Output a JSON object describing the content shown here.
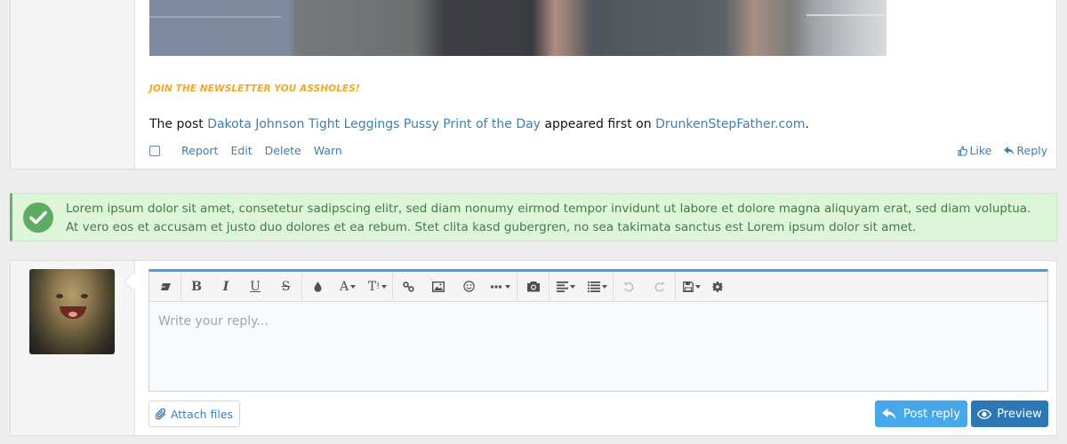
{
  "post": {
    "newsletter_text": "JOIN THE NEWSLETTER YOU ASSHOLES!",
    "text_prefix": "The post ",
    "post_link_text": "Dakota Johnson Tight Leggings Pussy Print of the Day",
    "text_middle": " appeared first on ",
    "site_link_text": "DrunkenStepFather.com",
    "text_suffix": ".",
    "actions": {
      "report": "Report",
      "edit": "Edit",
      "delete": "Delete",
      "warn": "Warn",
      "like": "Like",
      "reply": "Reply"
    }
  },
  "alert": {
    "type": "success",
    "icon": "check-circle-icon",
    "message": "Lorem ipsum dolor sit amet, consetetur sadipscing elitr, sed diam nonumy eirmod tempor invidunt ut labore et dolore magna aliquyam erat, sed diam voluptua. At vero eos et accusam et justo duo dolores et ea rebum. Stet clita kasd gubergren, no sea takimata sanctus est Lorem ipsum dolor sit amet."
  },
  "reply_form": {
    "placeholder": "Write your reply...",
    "value": "",
    "toolbar": [
      {
        "name": "clear-formatting",
        "icon": "eraser-icon"
      },
      {
        "name": "bold",
        "label": "B",
        "icon": "bold-icon"
      },
      {
        "name": "italic",
        "label": "I",
        "icon": "italic-icon"
      },
      {
        "name": "underline",
        "label": "U",
        "icon": "underline-icon"
      },
      {
        "name": "strikethrough",
        "label": "S",
        "icon": "strikethrough-icon"
      },
      {
        "name": "text-color",
        "icon": "droplet-icon"
      },
      {
        "name": "font-family",
        "label": "A",
        "icon": "font-icon"
      },
      {
        "name": "font-size",
        "label": "T",
        "icon": "text-size-icon"
      },
      {
        "name": "insert-link",
        "icon": "link-icon"
      },
      {
        "name": "insert-image",
        "icon": "image-icon"
      },
      {
        "name": "smilies",
        "icon": "smile-icon"
      },
      {
        "name": "more-options",
        "icon": "ellipsis-icon"
      },
      {
        "name": "insert-media",
        "icon": "camera-icon"
      },
      {
        "name": "align",
        "icon": "align-left-icon"
      },
      {
        "name": "list",
        "icon": "list-icon"
      },
      {
        "name": "undo",
        "icon": "undo-icon"
      },
      {
        "name": "redo",
        "icon": "redo-icon"
      },
      {
        "name": "drafts",
        "icon": "save-icon"
      },
      {
        "name": "options",
        "icon": "gear-icon"
      }
    ],
    "attach_label": "Attach files",
    "post_reply_label": "Post reply",
    "preview_label": "Preview"
  },
  "colors": {
    "link": "#3e7eb6",
    "newsletter": "#f5a623",
    "success_bg": "#dff5da",
    "success_text": "#3e7d44",
    "editor_accent": "#4a9be0",
    "post_reply_button": "#47a7eb",
    "preview_button": "#2d77b5"
  }
}
